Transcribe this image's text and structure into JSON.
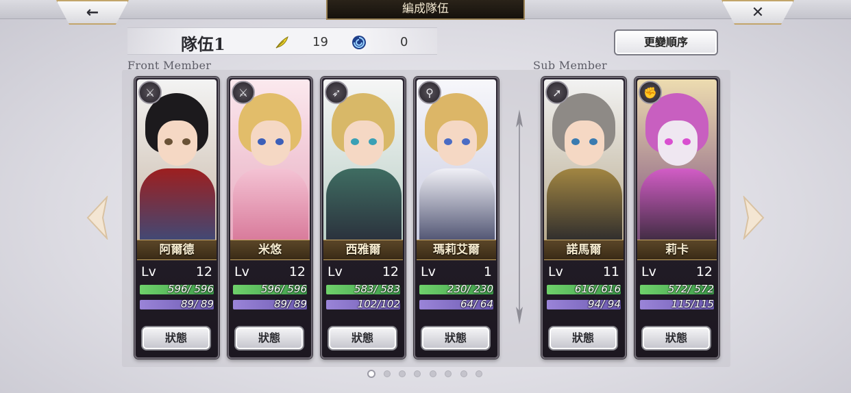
{
  "header": {
    "title": "編成隊伍",
    "back_label": "←",
    "close_label": "✕"
  },
  "team": {
    "name": "隊伍1",
    "stat1_value": "19",
    "stat2_value": "0"
  },
  "order_button_label": "更變順序",
  "sections": {
    "front": "Front Member",
    "sub": "Sub Member"
  },
  "level_label": "Lv",
  "status_label": "狀態",
  "front_members": [
    {
      "name": "阿爾德",
      "lv": "12",
      "hp": "596/ 596",
      "mp": "89/ 89",
      "weapon_icon": "sword-icon"
    },
    {
      "name": "米悠",
      "lv": "12",
      "hp": "596/ 596",
      "mp": "89/ 89",
      "weapon_icon": "sword-icon"
    },
    {
      "name": "西雅爾",
      "lv": "12",
      "hp": "583/ 583",
      "mp": "102/102",
      "weapon_icon": "bow-icon"
    },
    {
      "name": "瑪莉艾爾",
      "lv": "1",
      "hp": "230/ 230",
      "mp": "64/ 64",
      "weapon_icon": "staff-icon"
    }
  ],
  "sub_members": [
    {
      "name": "諾馬爾",
      "lv": "11",
      "hp": "616/ 616",
      "mp": "94/ 94",
      "weapon_icon": "spear-icon"
    },
    {
      "name": "莉卡",
      "lv": "12",
      "hp": "572/ 572",
      "mp": "115/115",
      "weapon_icon": "fist-icon"
    }
  ],
  "pagination": {
    "count": 8,
    "active": 0
  }
}
